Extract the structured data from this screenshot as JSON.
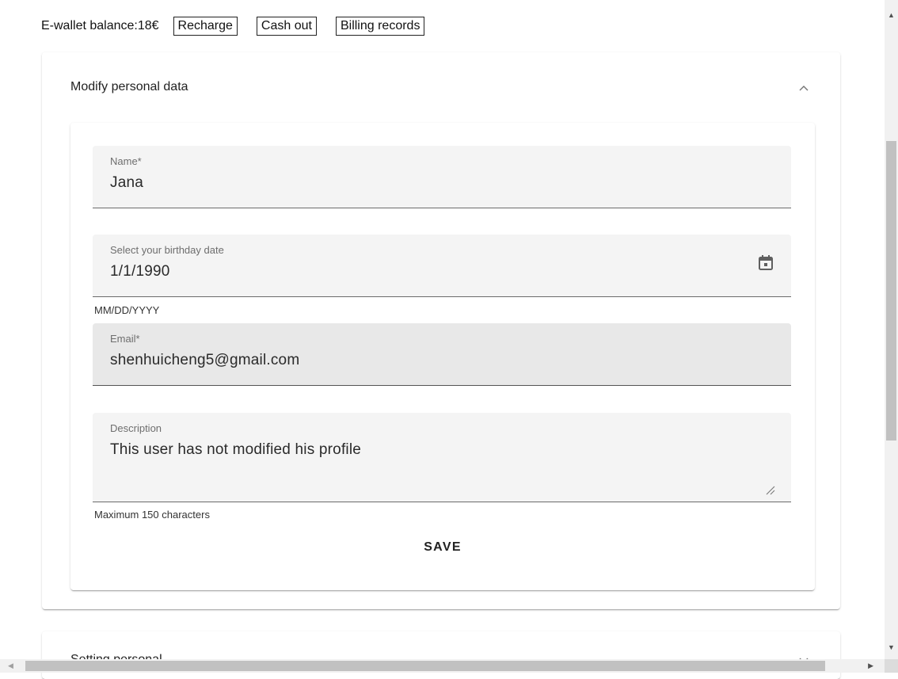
{
  "wallet": {
    "balance_text": "E-wallet balance:18€",
    "recharge_label": "Recharge",
    "cashout_label": "Cash out",
    "billing_label": "Billing records"
  },
  "profile_panel": {
    "title": "Modify personal data",
    "expanded": true,
    "form": {
      "name": {
        "label": "Name*",
        "value": "Jana"
      },
      "birthday": {
        "label": "Select your birthday date",
        "value": "1/1/1990",
        "hint": "MM/DD/YYYY"
      },
      "email": {
        "label": "Email*",
        "value": "shenhuicheng5@gmail.com",
        "disabled": true
      },
      "description": {
        "label": "Description",
        "value": "This user has not modified his profile",
        "hint": "Maximum 150 characters"
      },
      "save_label": "SAVE"
    }
  },
  "settings_panel": {
    "title": "Setting personal",
    "expanded": false
  },
  "icons": {
    "collapse": "chevron-up-icon",
    "expand": "chevron-down-icon",
    "calendar": "calendar-icon",
    "resize": "resize-handle-icon"
  },
  "colors": {
    "field_background": "#f4f4f4",
    "disabled_field_background": "#e8e8e8",
    "label_gray": "#6e6e6e"
  }
}
